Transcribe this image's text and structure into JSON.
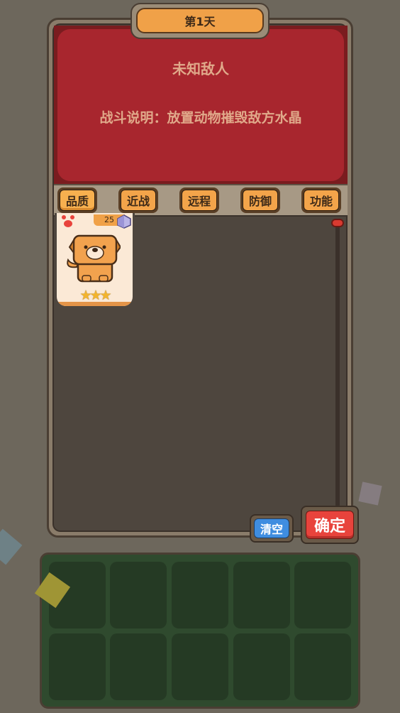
{
  "header": {
    "day_label": "第1天"
  },
  "info": {
    "enemy_name": "未知敌人",
    "battle_description": "战斗说明：放置动物摧毁敌方水晶"
  },
  "filters": [
    {
      "label": "品质",
      "active": true
    },
    {
      "label": "近战",
      "active": false
    },
    {
      "label": "远程",
      "active": false
    },
    {
      "label": "防御",
      "active": false
    },
    {
      "label": "功能",
      "active": false
    }
  ],
  "card": {
    "animal_icon": "dog-icon",
    "cost": "25",
    "stars": "★★★",
    "star_count": 3
  },
  "actions": {
    "clear_label": "清空",
    "confirm_label": "确定"
  },
  "team_slots": {
    "rows": 2,
    "columns": 5
  },
  "colors": {
    "background": "#6d675c",
    "info_red": "#a8262e",
    "filter_orange": "#f3a44a",
    "clear_blue": "#3f8de0",
    "confirm_red": "#e8433c",
    "slot_green": "#253a24"
  }
}
